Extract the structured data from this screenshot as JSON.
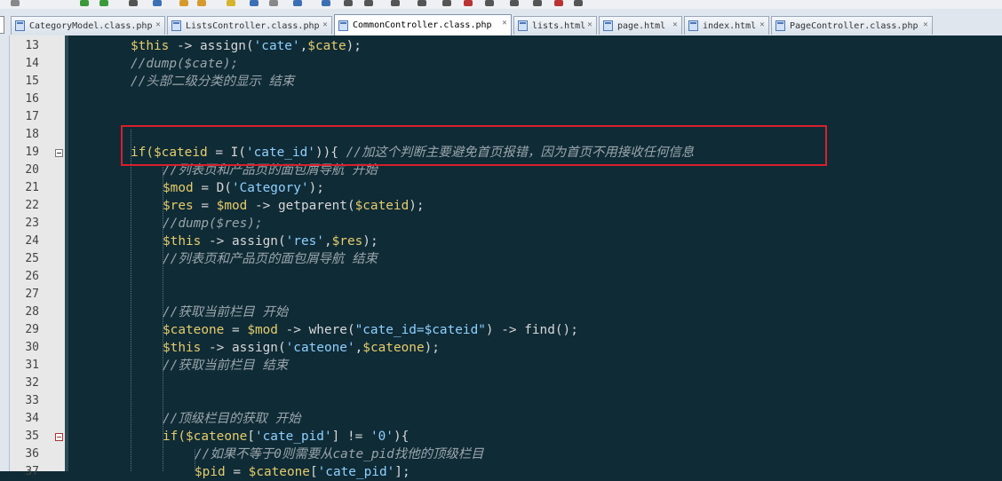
{
  "tabs": [
    {
      "label": "CategoryModel.class.php",
      "active": false
    },
    {
      "label": "ListsController.class.php",
      "active": false
    },
    {
      "label": "CommonController.class.php",
      "active": true
    },
    {
      "label": "lists.html",
      "active": false
    },
    {
      "label": "page.html",
      "active": false
    },
    {
      "label": "index.html",
      "active": false
    },
    {
      "label": "PageController.class.php",
      "active": false
    }
  ],
  "line_numbers": [
    "13",
    "14",
    "15",
    "16",
    "17",
    "18",
    "19",
    "20",
    "21",
    "22",
    "23",
    "24",
    "25",
    "26",
    "27",
    "28",
    "29",
    "30",
    "31",
    "32",
    "33",
    "34",
    "35",
    "36",
    "37"
  ],
  "code": {
    "l13_var": "$this",
    "l13_a": " -> assign(",
    "l13_s": "'cate'",
    "l13_b": ",",
    "l13_var2": "$cate",
    "l13_c": ");",
    "l14": "//dump($cate);",
    "l15": "//头部二级分类的显示 结束",
    "l19_a": "if(",
    "l19_var": "$cateid",
    "l19_b": " = I(",
    "l19_s": "'cate_id'",
    "l19_c": ")){ ",
    "l19_cm": "//加这个判断主要避免首页报错，因为首页不用接收任何信息",
    "l20": "//列表页和产品页的面包屑导航 开始",
    "l21_var": "$mod",
    "l21_a": " = D(",
    "l21_s": "'Category'",
    "l21_b": ");",
    "l22_var": "$res",
    "l22_a": " = ",
    "l22_var2": "$mod",
    "l22_b": " -> getparent(",
    "l22_var3": "$cateid",
    "l22_c": ");",
    "l23": "//dump($res);",
    "l24_var": "$this",
    "l24_a": " -> assign(",
    "l24_s": "'res'",
    "l24_b": ",",
    "l24_var2": "$res",
    "l24_c": ");",
    "l25": "//列表页和产品页的面包屑导航 结束",
    "l28": "//获取当前栏目 开始",
    "l29_var": "$cateone",
    "l29_a": " = ",
    "l29_var2": "$mod",
    "l29_b": " -> where(",
    "l29_s": "\"cate_id=$cateid\"",
    "l29_c": ") -> find();",
    "l30_var": "$this",
    "l30_a": " -> assign(",
    "l30_s": "'cateone'",
    "l30_b": ",",
    "l30_var2": "$cateone",
    "l30_c": ");",
    "l31": "//获取当前栏目 结束",
    "l34": "//顶级栏目的获取 开始",
    "l35_a": "if(",
    "l35_var": "$cateone",
    "l35_b": "[",
    "l35_s": "'cate_pid'",
    "l35_c": "] != ",
    "l35_s2": "'0'",
    "l35_d": "){",
    "l36": "//如果不等于0则需要从cate_pid找他的顶级栏目",
    "l37_var": "$pid",
    "l37_a": " = ",
    "l37_var2": "$cateone",
    "l37_b": "[",
    "l37_s": "'cate_pid'",
    "l37_c": "];"
  },
  "colors": {
    "editor_bg": "#0f2b36",
    "variable": "#e6cc6b",
    "string": "#8fd0ff",
    "comment": "#9aa5ab",
    "highlight_border": "#d7202c"
  }
}
